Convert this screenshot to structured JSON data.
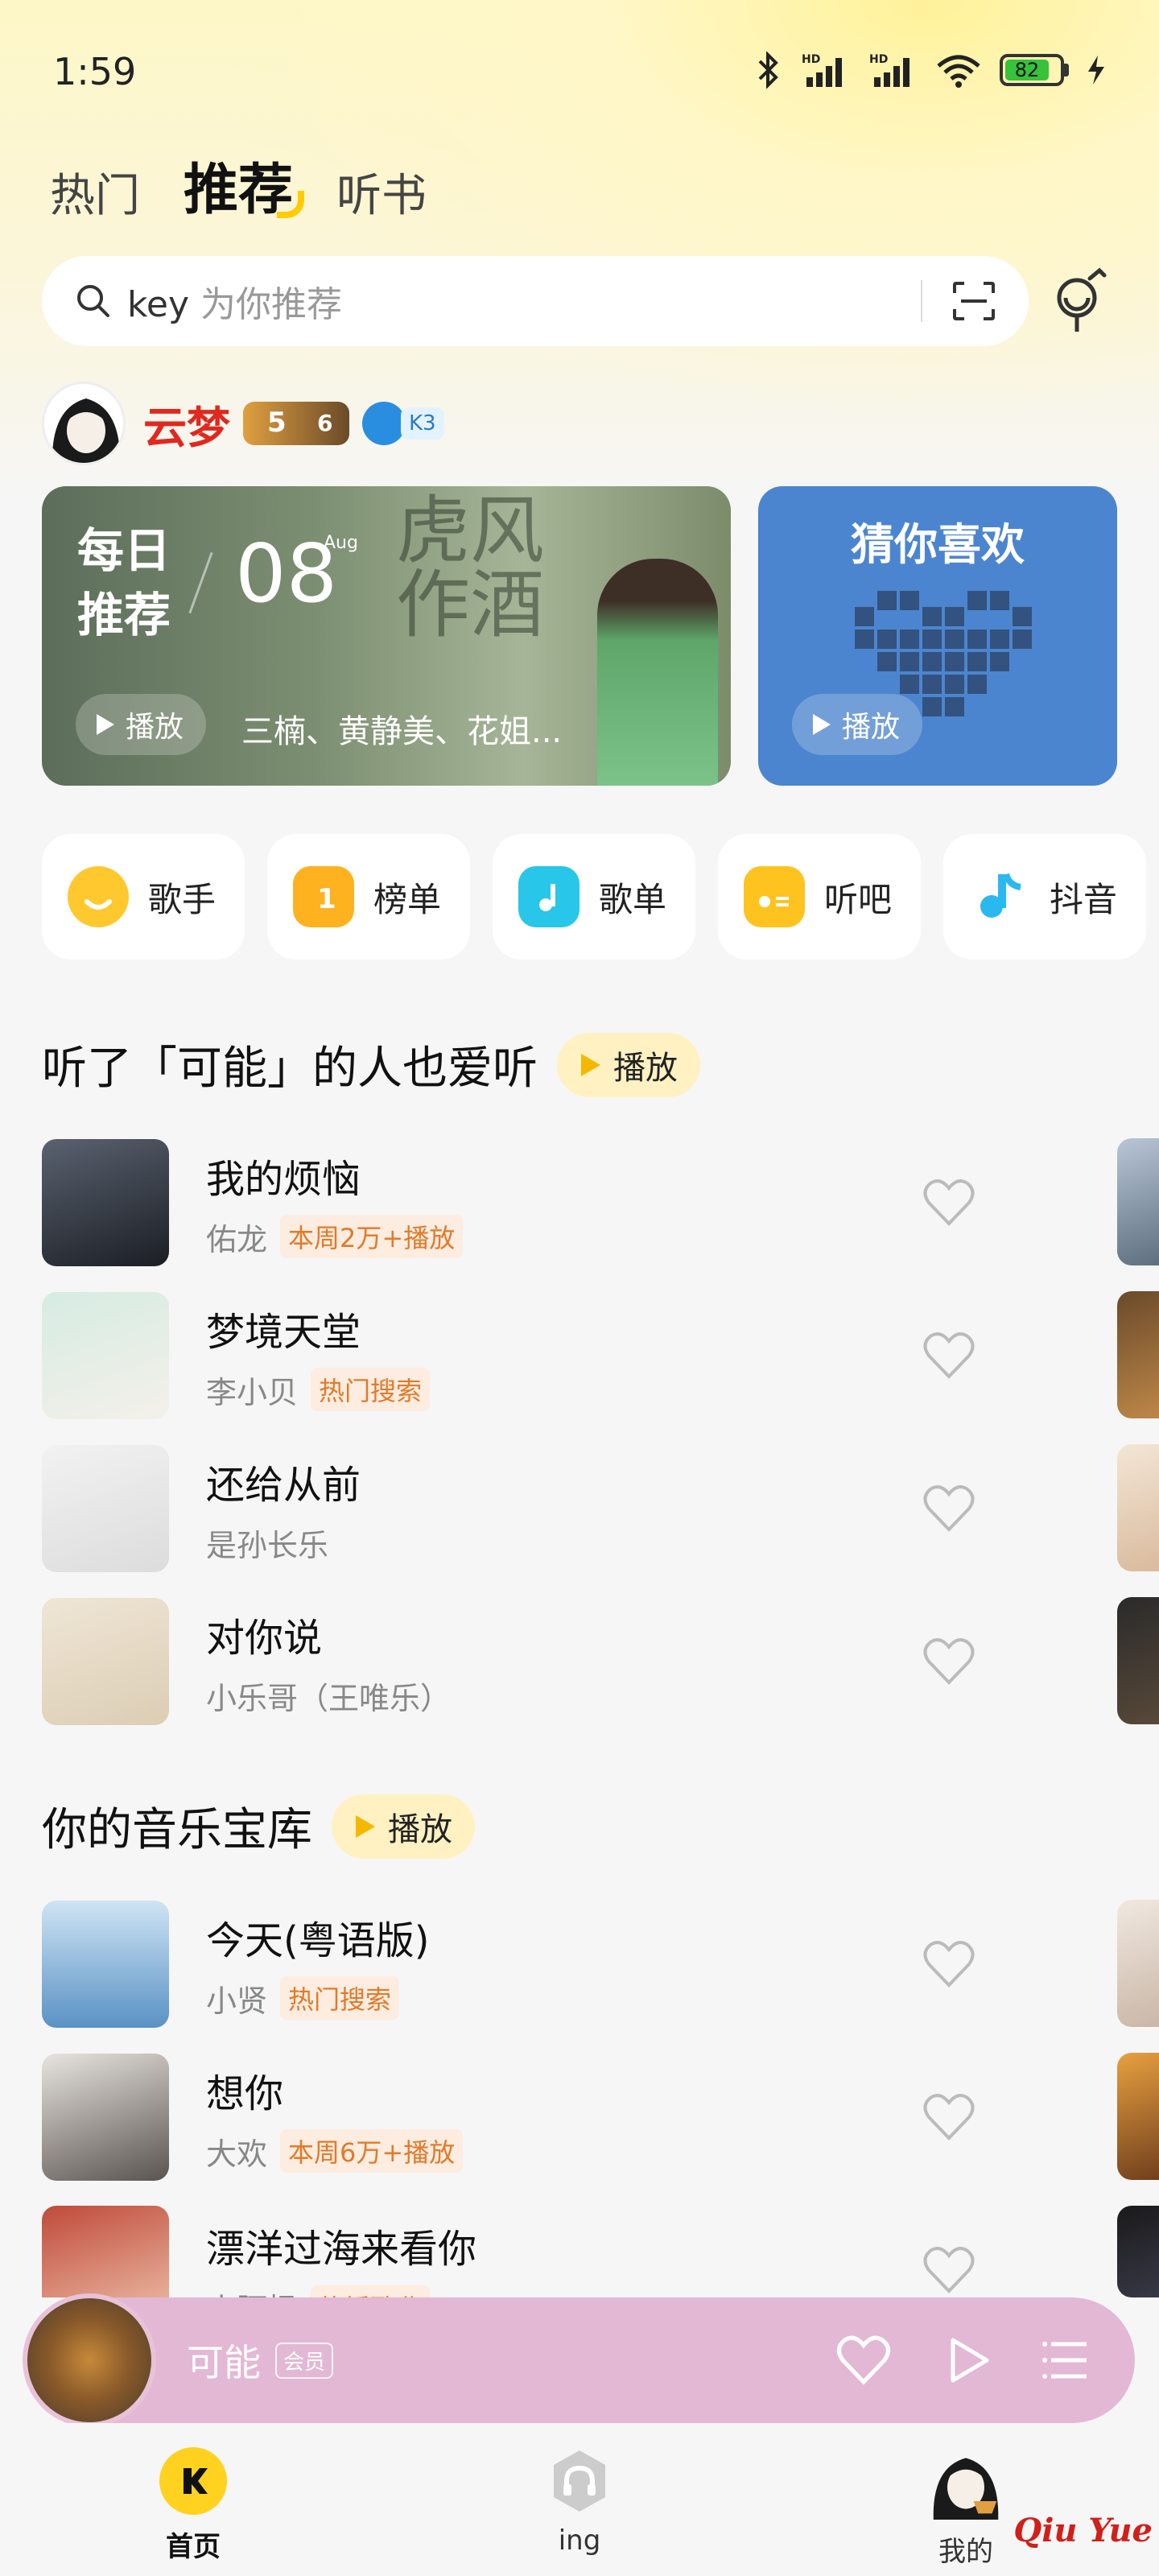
{
  "status_bar": {
    "time": "1:59",
    "battery": "82",
    "battery_level": 0.82,
    "icons": [
      "bluetooth-icon",
      "signal-hd-icon",
      "signal-hd-icon",
      "wifi-icon",
      "battery-icon",
      "charging-icon"
    ]
  },
  "top_tabs": [
    {
      "label": "热门"
    },
    {
      "label": "推荐",
      "active": true
    },
    {
      "label": "听书"
    }
  ],
  "search": {
    "keyword": "key",
    "placeholder": "为你推荐"
  },
  "user": {
    "name": "云梦",
    "vip_level_main": "5",
    "vip_level_sub": "6",
    "k_level": "K3"
  },
  "daily": {
    "title": "每日推荐",
    "day": "08",
    "month": "Aug",
    "play_label": "播放",
    "artists": "三楠、黄静美、花姐...",
    "art_text": "虎风作酒"
  },
  "guess": {
    "title": "猜你喜欢",
    "play_label": "播放"
  },
  "categories": [
    {
      "label": "歌手",
      "icon": "singer-icon",
      "color": "#ffc82e"
    },
    {
      "label": "榜单",
      "icon": "chart-icon",
      "color": "#ffb21f"
    },
    {
      "label": "歌单",
      "icon": "playlist-icon",
      "color": "#28c6e8"
    },
    {
      "label": "听吧",
      "icon": "radio-icon",
      "color": "#ffc31f"
    },
    {
      "label": "抖音",
      "icon": "douyin-icon",
      "color": "#2ab8f0"
    }
  ],
  "section1": {
    "title": "听了「可能」的人也爱听",
    "play_label": "播放",
    "songs": [
      {
        "title": "我的烦恼",
        "artist": "佑龙",
        "tag": "本周2万+播放"
      },
      {
        "title": "梦境天堂",
        "artist": "李小贝",
        "tag": "热门搜索"
      },
      {
        "title": "还给从前",
        "artist": "是孙长乐",
        "tag": ""
      },
      {
        "title": "对你说",
        "artist": "小乐哥（王唯乐）",
        "tag": ""
      }
    ]
  },
  "section2": {
    "title": "你的音乐宝库",
    "play_label": "播放",
    "songs": [
      {
        "title": "今天(粤语版)",
        "artist": "小贤",
        "tag": "热门搜索"
      },
      {
        "title": "想你",
        "artist": "大欢",
        "tag": "本周6万+播放"
      },
      {
        "title": "漂洋过海来看你",
        "artist": "小阿枫",
        "tag": "热播歌曲"
      }
    ]
  },
  "player": {
    "title": "可能",
    "badge": "会员"
  },
  "bottom_nav": [
    {
      "label": "首页",
      "active": true
    },
    {
      "label": "ing"
    },
    {
      "label": "我的"
    }
  ],
  "watermark": "Qiu Yue",
  "colors": {
    "accent": "#ffcc00",
    "user_name": "#e0281e",
    "tag": "#e07b2a",
    "player_bg": "#e3b8d4"
  }
}
